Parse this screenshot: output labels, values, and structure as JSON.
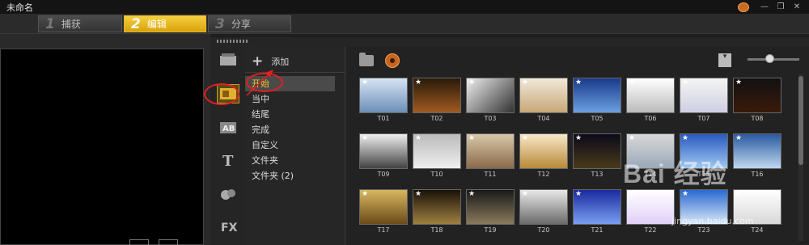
{
  "window": {
    "title": "未命名"
  },
  "tabs": [
    {
      "num": "1",
      "label": "捕获"
    },
    {
      "num": "2",
      "label": "编辑"
    },
    {
      "num": "3",
      "label": "分享"
    }
  ],
  "library": {
    "add_label": "添加",
    "categories": [
      "开始",
      "当中",
      "结尾",
      "完成",
      "自定义",
      "文件夹",
      "文件夹 (2)"
    ],
    "selected_category": "开始"
  },
  "thumbs": [
    {
      "label": "T01",
      "bg": "linear-gradient(#d6e4f4,#6c8fb8)"
    },
    {
      "label": "T02",
      "bg": "linear-gradient(#2a1a0a,#a05a20)"
    },
    {
      "label": "T03",
      "bg": "linear-gradient(135deg,#eee,#333)"
    },
    {
      "label": "T04",
      "bg": "linear-gradient(#f2e8d8,#c8a878)"
    },
    {
      "label": "T05",
      "bg": "linear-gradient(#1a3a8a,#6aa0e0)"
    },
    {
      "label": "T06",
      "bg": "linear-gradient(#fff,#bbb)"
    },
    {
      "label": "T07",
      "bg": "linear-gradient(#f4f4f4,#cfcfe4)"
    },
    {
      "label": "T08",
      "bg": "linear-gradient(#111,#3a1a0a)"
    },
    {
      "label": "T09",
      "bg": "linear-gradient(#eee,#444)"
    },
    {
      "label": "T10",
      "bg": "linear-gradient(#bbb,#eee)"
    },
    {
      "label": "T11",
      "bg": "linear-gradient(#d8c8a8,#8a6a4a)"
    },
    {
      "label": "T12",
      "bg": "linear-gradient(#f8e8c8,#b88838)"
    },
    {
      "label": "T13",
      "bg": "linear-gradient(#0a0a1a,#4a3a1a)"
    },
    {
      "label": "T14",
      "bg": "linear-gradient(#d8d8d8,#9aa8b8)"
    },
    {
      "label": "T15",
      "bg": "linear-gradient(#2a5ac0,#a0c8f0)"
    },
    {
      "label": "T16",
      "bg": "linear-gradient(#2a5aa0,#c0d8f0)"
    },
    {
      "label": "T17",
      "bg": "linear-gradient(#d8b860,#6a4a18)"
    },
    {
      "label": "T18",
      "bg": "linear-gradient(#1a1208,#a08040)"
    },
    {
      "label": "T19",
      "bg": "linear-gradient(#1a1a1a,#8a7a5a)"
    },
    {
      "label": "T20",
      "bg": "linear-gradient(#e8e8e8,#6a6a6a)"
    },
    {
      "label": "T21",
      "bg": "linear-gradient(#1a2aa0,#7aa0f0)"
    },
    {
      "label": "T22",
      "bg": "linear-gradient(#fff,#e0d0f8)"
    },
    {
      "label": "T23",
      "bg": "linear-gradient(#2a6ad0,#d8e8f8)"
    },
    {
      "label": "T24",
      "bg": "linear-gradient(#fff,#d8d8d8)"
    }
  ],
  "watermark": {
    "brand": "Bai 经验",
    "url": "jingyan.baidu.com"
  }
}
